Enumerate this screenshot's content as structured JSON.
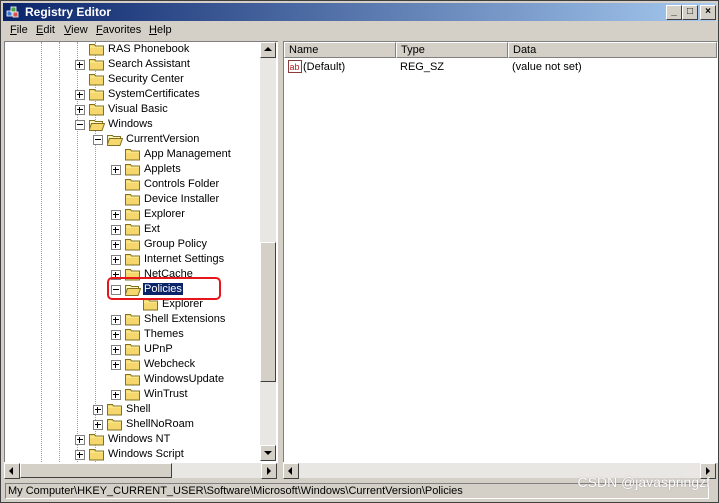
{
  "window": {
    "title": "Registry Editor"
  },
  "title_buttons": [
    "_",
    "□",
    "×"
  ],
  "menu": [
    {
      "key": "F",
      "rest": "ile"
    },
    {
      "key": "E",
      "rest": "dit"
    },
    {
      "key": "V",
      "rest": "iew"
    },
    {
      "key": "F",
      "rest": "avorites",
      "pre": ""
    },
    {
      "key": "H",
      "rest": "elp"
    }
  ],
  "tree": [
    {
      "label": "RAS Phonebook",
      "level": 3,
      "expander": "none"
    },
    {
      "label": "Search Assistant",
      "level": 3,
      "expander": "plus"
    },
    {
      "label": "Security Center",
      "level": 3,
      "expander": "none"
    },
    {
      "label": "SystemCertificates",
      "level": 3,
      "expander": "plus"
    },
    {
      "label": "Visual Basic",
      "level": 3,
      "expander": "plus"
    },
    {
      "label": "Windows",
      "level": 3,
      "expander": "minus"
    },
    {
      "label": "CurrentVersion",
      "level": 4,
      "expander": "minus"
    },
    {
      "label": "App Management",
      "level": 5,
      "expander": "none"
    },
    {
      "label": "Applets",
      "level": 5,
      "expander": "plus"
    },
    {
      "label": "Controls Folder",
      "level": 5,
      "expander": "none"
    },
    {
      "label": "Device Installer",
      "level": 5,
      "expander": "none"
    },
    {
      "label": "Explorer",
      "level": 5,
      "expander": "plus"
    },
    {
      "label": "Ext",
      "level": 5,
      "expander": "plus"
    },
    {
      "label": "Group Policy",
      "level": 5,
      "expander": "plus"
    },
    {
      "label": "Internet Settings",
      "level": 5,
      "expander": "plus"
    },
    {
      "label": "NetCache",
      "level": 5,
      "expander": "plus"
    },
    {
      "label": "Policies",
      "level": 5,
      "expander": "minus",
      "selected": true
    },
    {
      "label": "Explorer",
      "level": 6,
      "expander": "none"
    },
    {
      "label": "Shell Extensions",
      "level": 5,
      "expander": "plus"
    },
    {
      "label": "Themes",
      "level": 5,
      "expander": "plus"
    },
    {
      "label": "UPnP",
      "level": 5,
      "expander": "plus"
    },
    {
      "label": "Webcheck",
      "level": 5,
      "expander": "plus"
    },
    {
      "label": "WindowsUpdate",
      "level": 5,
      "expander": "none"
    },
    {
      "label": "WinTrust",
      "level": 5,
      "expander": "plus"
    },
    {
      "label": "Shell",
      "level": 4,
      "expander": "plus"
    },
    {
      "label": "ShellNoRoam",
      "level": 4,
      "expander": "plus"
    },
    {
      "label": "Windows NT",
      "level": 3,
      "expander": "plus"
    },
    {
      "label": "Windows Script",
      "level": 3,
      "expander": "plus"
    }
  ],
  "list": {
    "columns": [
      "Name",
      "Type",
      "Data"
    ],
    "rows": [
      {
        "icon": "string-value-icon",
        "name": "(Default)",
        "type": "REG_SZ",
        "data": "(value not set)"
      }
    ]
  },
  "status": {
    "path": "My Computer\\HKEY_CURRENT_USER\\Software\\Microsoft\\Windows\\CurrentVersion\\Policies"
  },
  "watermark": "CSDN @javaspringzf",
  "colors": {
    "title_start": "#0a246a",
    "title_end": "#a6caf0",
    "face": "#d4d0c8",
    "highlight_box": "#e8151b"
  }
}
